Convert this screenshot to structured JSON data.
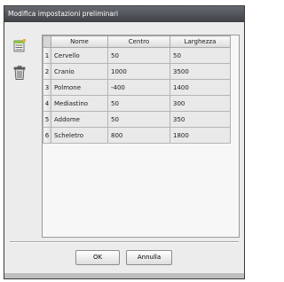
{
  "window": {
    "title": "Modifica impostazioni preliminari"
  },
  "toolbar": [
    {
      "icon": "list-icon"
    },
    {
      "icon": "trash-icon"
    }
  ],
  "table": {
    "columns": [
      "Nome",
      "Centro",
      "Larghezza"
    ],
    "rows": [
      {
        "num": "1",
        "nome": "Cervello",
        "centro": "50",
        "larghezza": "50"
      },
      {
        "num": "2",
        "nome": "Cranio",
        "centro": "1000",
        "larghezza": "3500"
      },
      {
        "num": "3",
        "nome": "Polmone",
        "centro": "-400",
        "larghezza": "1400"
      },
      {
        "num": "4",
        "nome": "Mediastino",
        "centro": "50",
        "larghezza": "300"
      },
      {
        "num": "5",
        "nome": "Addome",
        "centro": "50",
        "larghezza": "350"
      },
      {
        "num": "6",
        "nome": "Scheletro",
        "centro": "800",
        "larghezza": "1800"
      }
    ]
  },
  "buttons": {
    "ok": "OK",
    "cancel": "Annulla"
  }
}
